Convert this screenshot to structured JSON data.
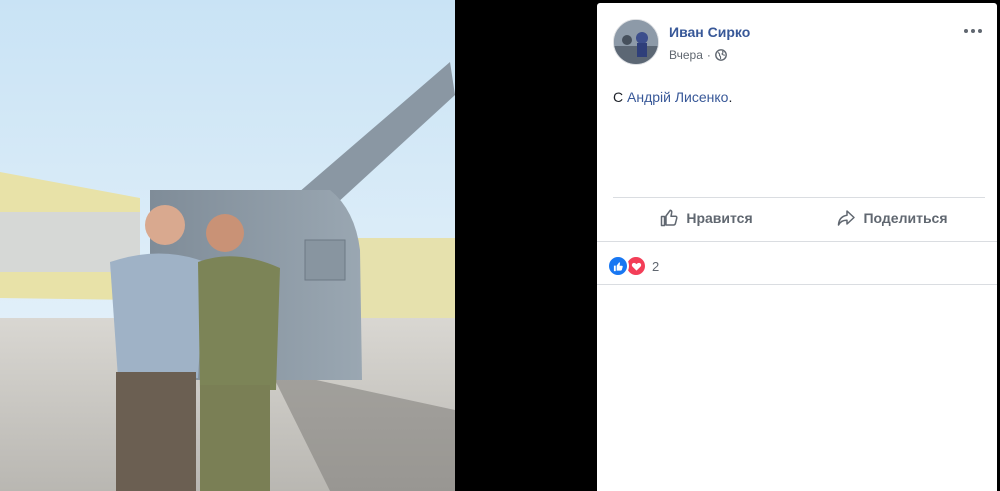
{
  "post": {
    "author": "Иван Сирко",
    "timestamp": "Вчера",
    "separator": "·",
    "privacy_icon": "globe-icon",
    "more_icon": "more-options-icon",
    "content_prefix": "С",
    "tagged_person": "Андрій Лисенко",
    "content_suffix": "."
  },
  "actions": {
    "like_label": "Нравится",
    "like_icon": "thumbs-up-icon",
    "share_label": "Поделиться",
    "share_icon": "share-arrow-icon"
  },
  "reactions": {
    "types": [
      "like-icon",
      "love-icon"
    ],
    "count": "2"
  },
  "colors": {
    "link": "#385898",
    "like_blue": "#1877f2",
    "love_red": "#f33e58",
    "muted": "#606770"
  }
}
